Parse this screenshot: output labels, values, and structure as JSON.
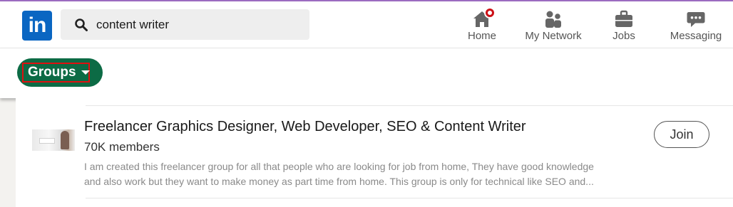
{
  "header": {
    "logo_text": "in",
    "search": {
      "value": "content writer",
      "icon": "search-icon"
    },
    "nav": [
      {
        "label": "Home",
        "icon": "home-icon",
        "has_notification": true
      },
      {
        "label": "My Network",
        "icon": "network-icon"
      },
      {
        "label": "Jobs",
        "icon": "briefcase-icon"
      },
      {
        "label": "Messaging",
        "icon": "chat-icon"
      }
    ]
  },
  "filter": {
    "label": "Groups",
    "icon": "caret-down-icon"
  },
  "result": {
    "title": "Freelancer Graphics Designer, Web Developer, SEO & Content Writer",
    "members": "70K members",
    "description_lines": [
      "I am created this freelancer group for all that people who are looking for job from home, They have good knowledge",
      "and also work but they want to make money as part time from home. This group is only for technical like SEO and..."
    ],
    "join_label": "Join"
  },
  "colors": {
    "brand": "#0a66c2",
    "filter_pill": "#0c6b45",
    "highlight": "#e01010",
    "notification": "#cc1016"
  }
}
